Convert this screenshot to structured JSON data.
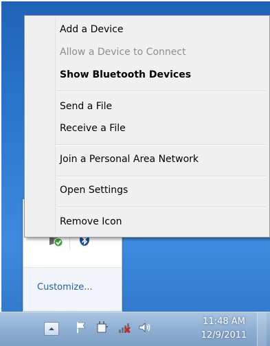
{
  "context_menu": {
    "items": [
      {
        "label": "Add a Device",
        "state": "normal"
      },
      {
        "label": "Allow a Device to Connect",
        "state": "disabled"
      },
      {
        "label": "Show Bluetooth Devices",
        "state": "default"
      },
      {
        "label": "Send a File",
        "state": "normal"
      },
      {
        "label": "Receive a File",
        "state": "normal"
      },
      {
        "label": "Join a Personal Area Network",
        "state": "normal"
      },
      {
        "label": "Open Settings",
        "state": "normal"
      },
      {
        "label": "Remove Icon",
        "state": "normal"
      }
    ]
  },
  "overflow_panel": {
    "icons": [
      "action-center-icon",
      "bluetooth-icon"
    ],
    "customize_label": "Customize..."
  },
  "taskbar": {
    "icons": [
      "show-hidden-icons-arrow",
      "action-center-flag-icon",
      "power-icon",
      "network-icon",
      "volume-icon"
    ],
    "clock_time": "11:48 AM",
    "clock_date": "12/9/2011"
  },
  "colors": {
    "desktop": "#2a77d0",
    "menu_bg": "#f0f0f0",
    "disabled_text": "#8d8d8d",
    "link": "#1e5ea8"
  }
}
